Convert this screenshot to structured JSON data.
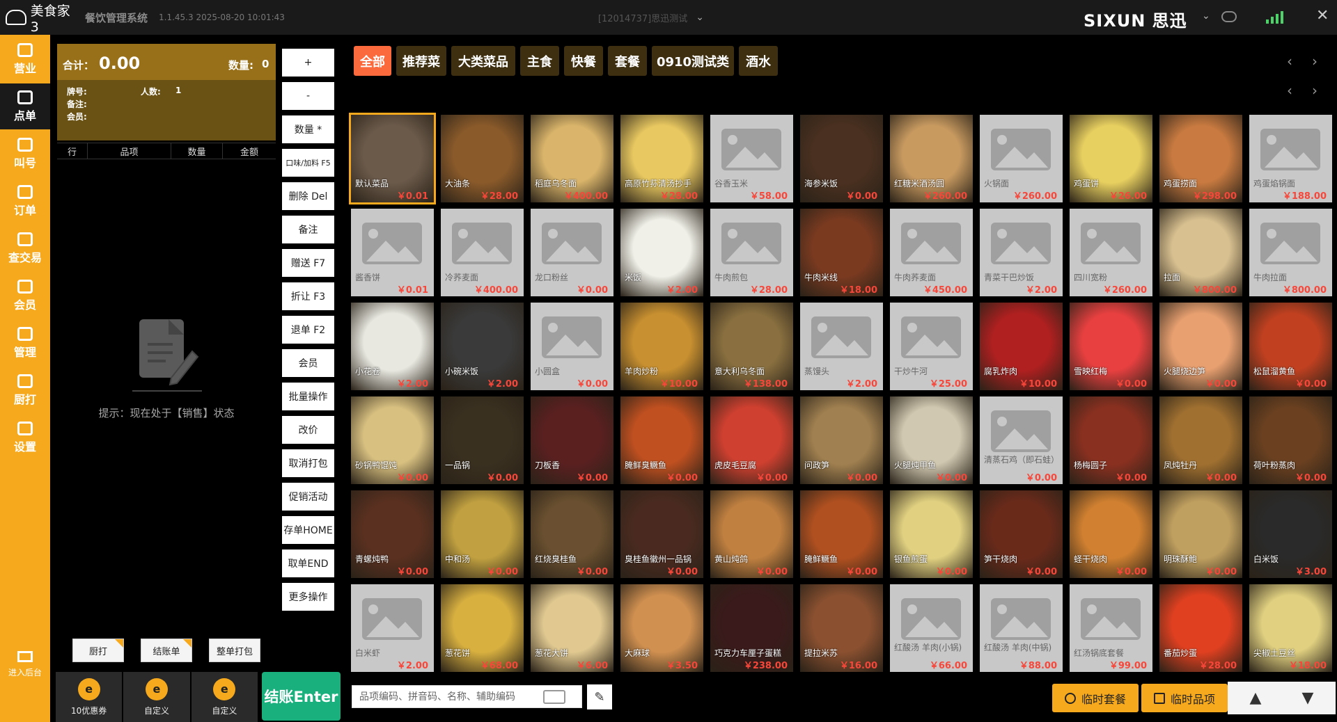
{
  "app": {
    "name": "美食家3",
    "subtitle": "餐饮管理系统",
    "version": "1.1.45.3 2025-08-20 10:01:43",
    "store": "[12014737]思迅测试",
    "brand": "SIXUN 思迅"
  },
  "nav": [
    {
      "label": "营业",
      "name": "nav-business",
      "icon": "shop-icon"
    },
    {
      "label": "点单",
      "name": "nav-order",
      "icon": "hand-icon",
      "active": true
    },
    {
      "label": "叫号",
      "name": "nav-call",
      "icon": "ticket-icon"
    },
    {
      "label": "订单",
      "name": "nav-orders",
      "icon": "list-icon"
    },
    {
      "label": "查交易",
      "name": "nav-transactions",
      "icon": "search-icon"
    },
    {
      "label": "会员",
      "name": "nav-member",
      "icon": "diamond-icon"
    },
    {
      "label": "管理",
      "name": "nav-manage",
      "icon": "grid-icon"
    },
    {
      "label": "厨打",
      "name": "nav-kitchen",
      "icon": "printer-icon"
    },
    {
      "label": "设置",
      "name": "nav-settings",
      "icon": "gear-icon"
    }
  ],
  "nav_backend": "进入后台",
  "order": {
    "total_label": "合计：",
    "total": "0.00",
    "qty_label": "数量:",
    "qty": "0",
    "table_label": "牌号:",
    "people_label": "人数:",
    "people": "1",
    "remark_label": "备注:",
    "member_label": "会员:",
    "columns": [
      "行",
      "品项",
      "数量",
      "金额"
    ],
    "empty_tip": "提示：现在处于【销售】状态"
  },
  "order_buttons": {
    "kitchen": "厨打",
    "bill": "结账单",
    "pack_all": "整单打包"
  },
  "bottom_tiles": [
    {
      "label": "10优惠券"
    },
    {
      "label": "自定义"
    },
    {
      "label": "自定义"
    }
  ],
  "checkout": "结账Enter",
  "actions": [
    "+",
    "-",
    "数量 *",
    "口味/加料 F5",
    "删除 Del",
    "备注",
    "赠送 F7",
    "折让 F3",
    "退单 F2",
    "会员",
    "批量操作",
    "改价",
    "取消打包",
    "促销活动",
    "存单HOME",
    "取单END",
    "更多操作"
  ],
  "categories": [
    {
      "label": "全部",
      "active": true
    },
    {
      "label": "推荐菜"
    },
    {
      "label": "大类菜品"
    },
    {
      "label": "主食"
    },
    {
      "label": "快餐"
    },
    {
      "label": "套餐"
    },
    {
      "label": "0910测试类"
    },
    {
      "label": "酒水"
    }
  ],
  "dishes": [
    {
      "name": "默认菜品",
      "price": "￥0.01",
      "photo": true,
      "color": "#6b5a4a",
      "selected": true
    },
    {
      "name": "大油条",
      "price": "￥28.00",
      "photo": true,
      "color": "#8a5a2a"
    },
    {
      "name": "稻庭乌冬面",
      "price": "￥400.00",
      "photo": true,
      "color": "#d9b46a"
    },
    {
      "name": "高原竹荪清汤抄手",
      "price": "￥28.00",
      "photo": true,
      "color": "#e8c860"
    },
    {
      "name": "谷香玉米",
      "price": "￥58.00",
      "photo": false
    },
    {
      "name": "海参米饭",
      "price": "￥0.00",
      "photo": true,
      "color": "#4a3020"
    },
    {
      "name": "红糖米酒汤圆",
      "price": "￥260.00",
      "photo": true,
      "color": "#c89a60"
    },
    {
      "name": "火锅面",
      "price": "￥260.00",
      "photo": false
    },
    {
      "name": "鸡蛋饼",
      "price": "￥26.00",
      "photo": true,
      "color": "#e8d060"
    },
    {
      "name": "鸡蛋捞面",
      "price": "￥298.00",
      "photo": true,
      "color": "#c87a40"
    },
    {
      "name": "鸡蛋焰锅面",
      "price": "￥188.00",
      "photo": false
    },
    {
      "name": "酱香饼",
      "price": "￥0.01",
      "photo": false
    },
    {
      "name": "冷荞麦面",
      "price": "￥400.00",
      "photo": false
    },
    {
      "name": "龙口粉丝",
      "price": "￥0.00",
      "photo": false
    },
    {
      "name": "米饭",
      "price": "￥2.00",
      "photo": true,
      "color": "#f0f0e8"
    },
    {
      "name": "牛肉煎包",
      "price": "￥28.00",
      "photo": false
    },
    {
      "name": "牛肉米线",
      "price": "￥18.00",
      "photo": true,
      "color": "#7a3a20"
    },
    {
      "name": "牛肉荞麦面",
      "price": "￥450.00",
      "photo": false
    },
    {
      "name": "青菜干巴炒饭",
      "price": "￥2.00",
      "photo": false
    },
    {
      "name": "四川宽粉",
      "price": "￥260.00",
      "photo": false
    },
    {
      "name": "拉面",
      "price": "￥800.00",
      "photo": true,
      "color": "#d8c090"
    },
    {
      "name": "牛肉拉面",
      "price": "￥800.00",
      "photo": false
    },
    {
      "name": "小花卷",
      "price": "￥2.00",
      "photo": true,
      "color": "#e8e8e0"
    },
    {
      "name": "小碗米饭",
      "price": "￥2.00",
      "photo": true,
      "color": "#3a3a3a"
    },
    {
      "name": "小圆盒",
      "price": "￥0.00",
      "photo": false
    },
    {
      "name": "羊肉炒粉",
      "price": "￥10.00",
      "photo": true,
      "color": "#c89030"
    },
    {
      "name": "意大利乌冬面",
      "price": "￥138.00",
      "photo": true,
      "color": "#8a7040"
    },
    {
      "name": "蒸馒头",
      "price": "￥2.00",
      "photo": false
    },
    {
      "name": "干炒牛河",
      "price": "￥25.00",
      "photo": false
    },
    {
      "name": "腐乳炸肉",
      "price": "￥10.00",
      "photo": true,
      "color": "#b02020"
    },
    {
      "name": "雪映红梅",
      "price": "￥0.00",
      "photo": true,
      "color": "#e84040"
    },
    {
      "name": "火腿烧边笋",
      "price": "￥0.00",
      "photo": true,
      "color": "#e8a070"
    },
    {
      "name": "松鼠溜黄鱼",
      "price": "￥0.00",
      "photo": true,
      "color": "#c04020"
    },
    {
      "name": "砂锅鸭馄饨",
      "price": "￥0.00",
      "photo": true,
      "color": "#d8c080"
    },
    {
      "name": "一品锅",
      "price": "￥0.00",
      "photo": true,
      "color": "#3a3020"
    },
    {
      "name": "刀板香",
      "price": "￥0.00",
      "photo": true,
      "color": "#5a2020"
    },
    {
      "name": "腌鲜臭鳜鱼",
      "price": "￥0.00",
      "photo": true,
      "color": "#c05020"
    },
    {
      "name": "虎皮毛豆腐",
      "price": "￥0.00",
      "photo": true,
      "color": "#d04030"
    },
    {
      "name": "问政笋",
      "price": "￥0.00",
      "photo": true,
      "color": "#a08050"
    },
    {
      "name": "火腿炖甲鱼",
      "price": "￥0.00",
      "photo": true,
      "color": "#d0c8b0"
    },
    {
      "name": "清蒸石鸡（即石蛙）",
      "price": "￥0.00",
      "photo": false
    },
    {
      "name": "杨梅圆子",
      "price": "￥0.00",
      "photo": true,
      "color": "#8a3020"
    },
    {
      "name": "凤炖牡丹",
      "price": "￥0.00",
      "photo": true,
      "color": "#a07030"
    },
    {
      "name": "荷叶粉蒸肉",
      "price": "￥0.00",
      "photo": true,
      "color": "#6a4020"
    },
    {
      "name": "青螺炖鸭",
      "price": "￥0.00",
      "photo": true,
      "color": "#5a3020"
    },
    {
      "name": "中和汤",
      "price": "￥0.00",
      "photo": true,
      "color": "#c0a040"
    },
    {
      "name": "红烧臭桂鱼",
      "price": "￥0.00",
      "photo": true,
      "color": "#6a5030"
    },
    {
      "name": "臭桂鱼徽州一品锅",
      "price": "￥0.00",
      "photo": true,
      "color": "#4a2a20"
    },
    {
      "name": "黄山炖鸽",
      "price": "￥0.00",
      "photo": true,
      "color": "#c08040"
    },
    {
      "name": "腌鲜鳜鱼",
      "price": "￥0.00",
      "photo": true,
      "color": "#b05020"
    },
    {
      "name": "银鱼煎蛋",
      "price": "￥0.00",
      "photo": true,
      "color": "#e0d080"
    },
    {
      "name": "笋干烧肉",
      "price": "￥0.00",
      "photo": true,
      "color": "#6a2a1a"
    },
    {
      "name": "蛏干烧肉",
      "price": "￥0.00",
      "photo": true,
      "color": "#d08030"
    },
    {
      "name": "明珠酥鲍",
      "price": "￥0.00",
      "photo": true,
      "color": "#c0a060"
    },
    {
      "name": "白米饭",
      "price": "￥3.00",
      "photo": true,
      "color": "#2a2a2a"
    },
    {
      "name": "白米虾",
      "price": "￥2.00",
      "photo": false
    },
    {
      "name": "葱花饼",
      "price": "￥68.00",
      "photo": true,
      "color": "#d8b040"
    },
    {
      "name": "葱花大饼",
      "price": "￥6.00",
      "photo": true,
      "color": "#e0c890"
    },
    {
      "name": "大麻球",
      "price": "￥3.50",
      "photo": true,
      "color": "#d09050"
    },
    {
      "name": "巧克力车厘子蛋糕",
      "price": "￥238.00",
      "photo": true,
      "color": "#3a1a1a"
    },
    {
      "name": "提拉米苏",
      "price": "￥16.00",
      "photo": true,
      "color": "#8a5030"
    },
    {
      "name": "红酸汤 羊肉(小锅)",
      "price": "￥66.00",
      "photo": false
    },
    {
      "name": "红酸汤 羊肉(中锅)",
      "price": "￥88.00",
      "photo": false
    },
    {
      "name": "红汤锅底套餐",
      "price": "￥99.00",
      "photo": false
    },
    {
      "name": "番茄炒蛋",
      "price": "￥28.00",
      "photo": true,
      "color": "#e04020"
    },
    {
      "name": "尖椒土豆丝",
      "price": "￥18.00",
      "photo": true,
      "color": "#e0d080"
    }
  ],
  "search": {
    "placeholder": "品项编码、拼音码、名称、辅助编码"
  },
  "footer_buttons": {
    "temp_set": "临时套餐",
    "temp_item": "临时品项"
  },
  "colors": {
    "accent": "#f6a91c",
    "active_tab": "#fb6a3c",
    "checkout": "#19b07d",
    "price": "#f7463a"
  }
}
